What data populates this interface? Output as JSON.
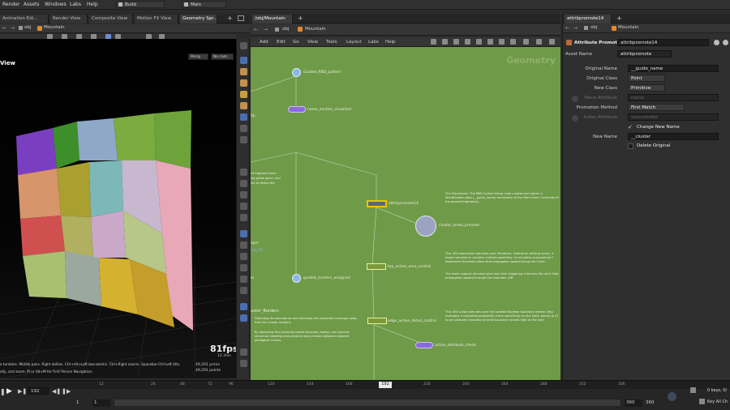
{
  "menu": {
    "render": "Render",
    "assets": "Assets",
    "windows": "Windows",
    "labs": "Labs",
    "help": "Help",
    "desktop": "Build",
    "context": "Main"
  },
  "left_tabs": [
    "Animation Edi...",
    "Render View",
    "Composite View",
    "Motion FX View",
    "Geometry Spr..."
  ],
  "left_path": {
    "root": "obj",
    "node": "Mountain"
  },
  "viewport": {
    "title": "View",
    "persp": "Persp",
    "cam": "No cam",
    "fps": "81fps",
    "ms": "12.3ms",
    "prims": "49,291 prims",
    "points": "49,291 points",
    "hint1": "e tumbles. Middle pans. Right dollies. Ctrl+Alt+Left box-zooms. Ctrl+Right zooms. Spacebar-Ctrl-Left tilts.",
    "hint2": "olly, and zoom.  M or Alt+M for First Person Navigation."
  },
  "ng": {
    "tab": "/obj/Mountain",
    "root": "obj",
    "node": "Mountain",
    "menu": [
      "Add",
      "Edit",
      "Go",
      "View",
      "Tools",
      "Layout",
      "Labs",
      "Help"
    ],
    "watermark": "Geometry",
    "nodes": {
      "n1": "Guided_RBD_pattern",
      "n2": "name_section_visualizer",
      "n3": "attribpromote14",
      "n4": "cluster_areas_preview",
      "n5": "top_active_area_control",
      "n6": "guided_clusters_assigned",
      "n7": "edge_active_detail_control",
      "n8": "active_attribute_check"
    },
    "side_labels": {
      "a": "ifp",
      "b": "ayer",
      "c": "nig_FD",
      "d": "uster_Borders",
      "e": "es fragment back",
      "f": "ing guide piece, and",
      "g": "ule to define the",
      "h": "ai"
    },
    "notes": {
      "n1": "The Disconnect: The RBD Guided Setup node creates and stores cl identification data (__guide_name) exclusively at the Point class l centroids of the packed fragments).",
      "n2": "This VEX expression executes over Primitives. Instead of utilizing heavy, e target volumes or complex collision geometry, it calculates a procedural f dependent threshold plane that propagates upward along the Y-axis.",
      "n3": "The lower support structure give way first, triggering a domino-like verti float propagates upward through the mountain cliff.",
      "n4": "Detecting the boundaries and shrinking the constraint coverage away from the cluster margins.",
      "n5": "By deploying this proximity-based boundary lookup, you prevent structural bleeding and preserve sharp breaks between adjacent geological chunks.",
      "n6": "This VEX script executes over the isolated Boolean boundary stream (edg evaluates a controlled probability check specifically on the static pieces (a 0) to pre-activate a handful of small boundary shards right at the start"
    }
  },
  "pp": {
    "tab": "attribpromote14",
    "root": "obj",
    "node": "Mountain",
    "type": "Attribute Promote",
    "name": "attribpromote14",
    "asset_label": "Asset Name",
    "asset_value": "attribpromote",
    "rows": [
      {
        "label": "Original Name",
        "value": "__guide_name"
      },
      {
        "label": "Original Class",
        "value": "Point"
      },
      {
        "label": "New Class",
        "value": "Primitive"
      },
      {
        "label": "Piece Attribute",
        "value": "name"
      },
      {
        "label": "Promotion Method",
        "value": "First Match"
      },
      {
        "label": "Index Attribute",
        "value": "sourceindex"
      }
    ],
    "change_new_name": "Change New Name",
    "new_name_label": "New Name",
    "new_name_value": "__cluster",
    "delete_original": "Delete Original"
  },
  "timeline": {
    "ticks": [
      "12",
      "24",
      "48",
      "72",
      "96",
      "120",
      "144",
      "168",
      "216",
      "240",
      "264",
      "288",
      "312",
      "336"
    ],
    "current": "192",
    "frame": "192",
    "start": "1",
    "start2": "1",
    "end": "360",
    "end2": "360",
    "keys": "0 keys, 0/",
    "keyall": "Key All Ch"
  },
  "colors": {
    "network_bg": "#6f9a48",
    "node_select": "#f2c200",
    "accent": "#7a5cd0"
  }
}
